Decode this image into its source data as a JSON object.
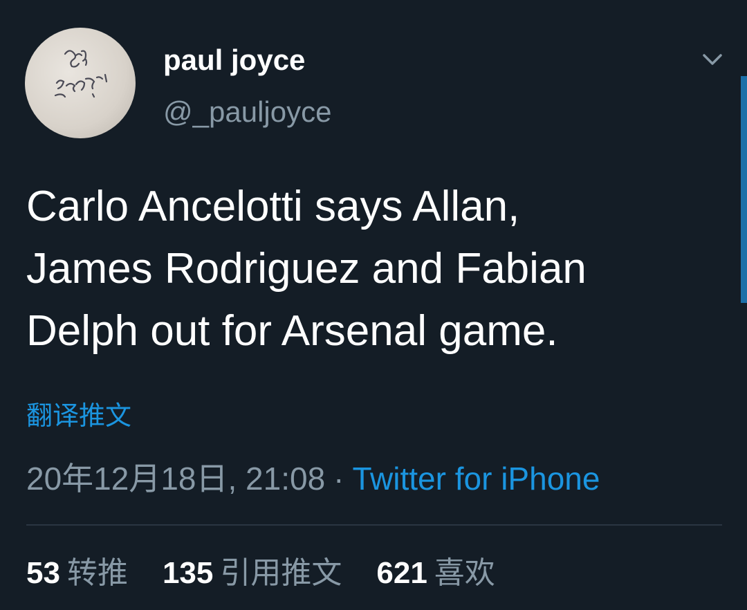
{
  "tweet": {
    "display_name": "paul joyce",
    "handle": "@_pauljoyce",
    "text_lines": [
      "Carlo Ancelotti says Allan,",
      "James Rodriguez and Fabian",
      "Delph out for Arsenal game."
    ],
    "translate_label": "翻译推文",
    "timestamp": "20年12月18日, 21:08",
    "separator": "·",
    "source": "Twitter for iPhone"
  },
  "stats": [
    {
      "count": "53",
      "label": "转推"
    },
    {
      "count": "135",
      "label": "引用推文"
    },
    {
      "count": "621",
      "label": "喜欢"
    }
  ],
  "icons": {
    "menu": "chevron-down-icon",
    "avatar": "handwriting-avatar"
  },
  "colors": {
    "background": "#141d26",
    "text": "#ffffff",
    "secondary": "#8899a6",
    "accent": "#1b95e0"
  }
}
